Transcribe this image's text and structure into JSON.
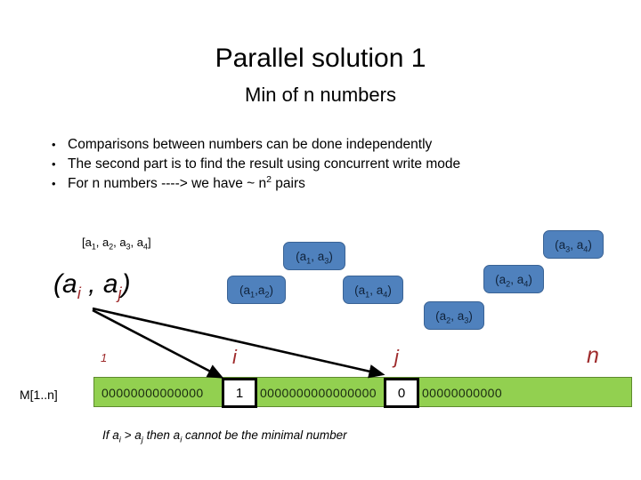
{
  "slide": {
    "title": "Parallel solution 1",
    "subtitle": "Min of n numbers"
  },
  "bullets": [
    {
      "marker": "•",
      "text": "Comparisons between numbers can be done independently"
    },
    {
      "marker": "•",
      "text": "The second part is to find the result using concurrent write mode"
    },
    {
      "marker": "•",
      "text": "For n numbers ----> we have ~ n² pairs"
    }
  ],
  "diagram": {
    "array_label": "[a1, a2, a3, a4]",
    "pair_expression": {
      "open": "(a",
      "sub1": "i",
      "comma": " , a",
      "sub2": "j",
      "close": ")"
    },
    "pair_boxes": [
      {
        "name": "pair-a1-a3",
        "label": "(a1, a3)"
      },
      {
        "name": "pair-a1-a2",
        "label": "(a1,a2)"
      },
      {
        "name": "pair-a1-a4",
        "label": "(a1, a4)"
      },
      {
        "name": "pair-a3-a4",
        "label": "(a3, a4)"
      },
      {
        "name": "pair-a2-a4",
        "label": "(a2, a4)"
      },
      {
        "name": "pair-a2-a3",
        "label": "(a2, a3)"
      }
    ]
  },
  "memory": {
    "label": "M[1..n]",
    "index_start": "1",
    "index_i": "i",
    "index_j": "j",
    "index_end": "n",
    "zeros_left": "00000000000000",
    "zeros_middle": "0000000000000000",
    "zeros_right": "00000000000",
    "cell_i_value": "1",
    "cell_j_value": "0"
  },
  "caption": {
    "p1": "If a",
    "s1": "i",
    "p2": " > a",
    "s2": "j",
    "p3": " then  a",
    "s3": "i",
    "p4": " cannot be  the minimal number"
  },
  "colors": {
    "pair_box_fill": "#4F81BD",
    "pair_box_border": "#3A6395",
    "memory_bar_fill": "#92D050",
    "memory_bar_border": "#5E8A2E",
    "index_text": "#9E2A2B",
    "arrow": "#000000",
    "text": "#000000",
    "background": "#FFFFFF"
  }
}
